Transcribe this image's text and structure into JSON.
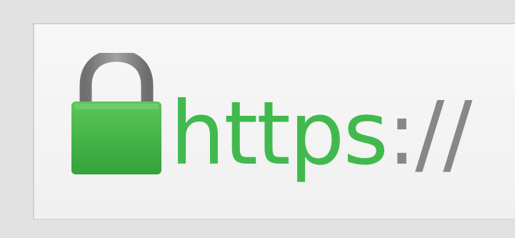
{
  "address_bar": {
    "scheme": "https",
    "separator": "://",
    "security_icon": "padlock-icon",
    "colors": {
      "secure_scheme": "#41b94e",
      "separator": "#878787",
      "lock_body": "#44b549",
      "lock_shackle": "#7d7d7d"
    }
  }
}
